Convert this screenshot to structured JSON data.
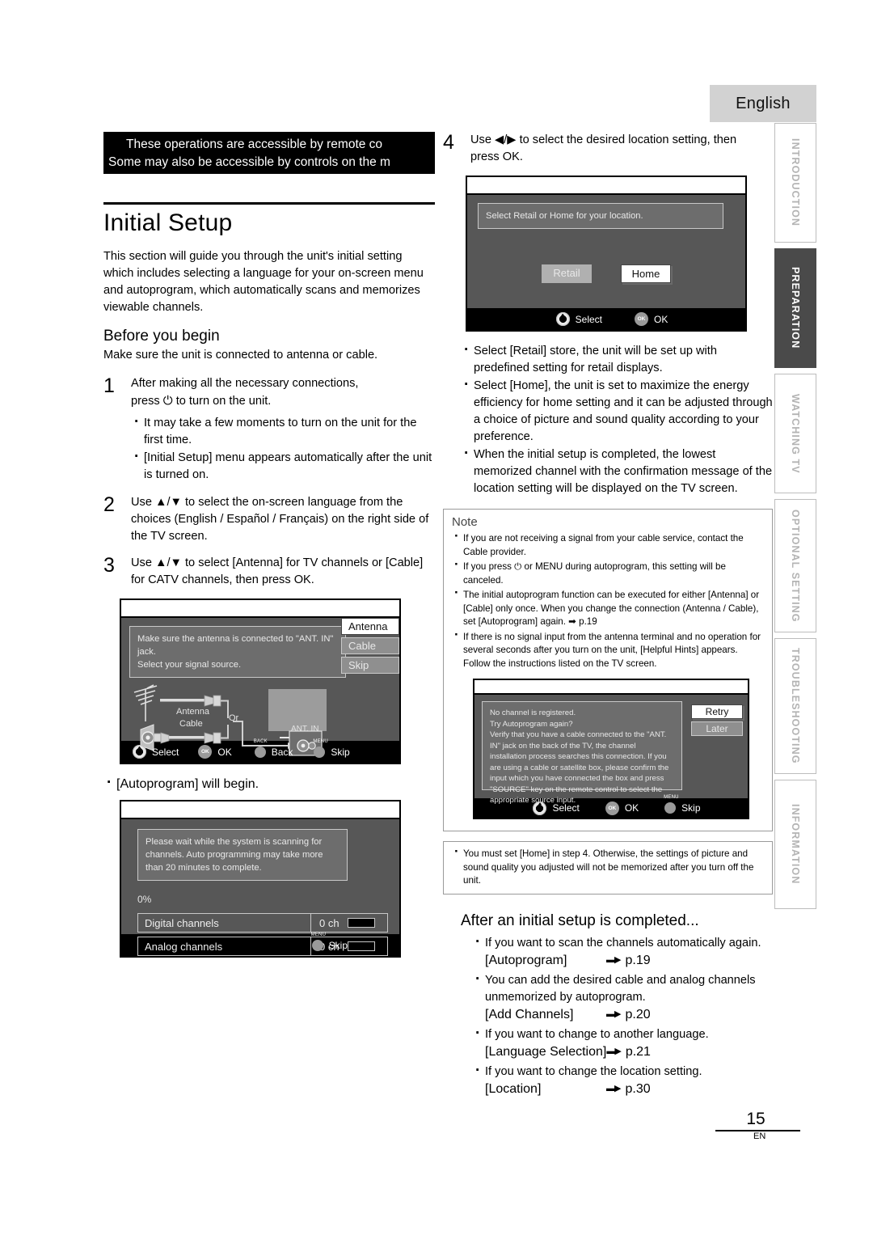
{
  "language_tab": "English",
  "side_tabs": [
    {
      "label": "INTRODUCTION",
      "active": false
    },
    {
      "label": "PREPARATION",
      "active": true
    },
    {
      "label": "WATCHING TV",
      "active": false
    },
    {
      "label": "OPTIONAL SETTING",
      "active": false
    },
    {
      "label": "TROUBLESHOOTING",
      "active": false
    },
    {
      "label": "INFORMATION",
      "active": false
    }
  ],
  "banner": {
    "line1": "These operations are accessible by remote co",
    "line2": "Some may also be accessible by controls on the m"
  },
  "title": "Initial Setup",
  "intro": "This section will guide you through the unit's initial setting which includes selecting a language for your on-screen menu and autoprogram, which automatically scans and memorizes viewable channels.",
  "before": {
    "heading": "Before you begin",
    "text": "Make sure the unit is connected to antenna or cable."
  },
  "steps": {
    "s1": {
      "num": "1",
      "line1": "After making all the necessary connections,",
      "line2_pre": "press",
      "line2_post": "to turn on the unit.",
      "power_icon": "power-icon",
      "bullets": [
        "It may take a few moments to turn on the unit for the first time.",
        "[Initial Setup] menu appears automatically after the unit is turned on."
      ]
    },
    "s2": {
      "num": "2",
      "text": "Use ▲/▼ to select the on-screen language from the choices (English / Español / Français) on the right side of the TV screen."
    },
    "s3": {
      "num": "3",
      "line1": "Use ▲/▼ to select [Antenna] for TV channels or [Cable]",
      "line2": "for CATV channels, then press OK."
    },
    "s4": {
      "num": "4",
      "line1": "Use ◀/▶ to select the desired location setting, then",
      "line2": "press OK."
    }
  },
  "screen_antenna": {
    "message_line1": "Make sure the antenna is connected to \"ANT. IN\" jack.",
    "message_line2": "Select your signal source.",
    "options": [
      {
        "label": "Antenna",
        "selected": true
      },
      {
        "label": "Cable",
        "selected": false
      },
      {
        "label": "Skip",
        "selected": false
      }
    ],
    "diagram": {
      "antenna_label": "Antenna",
      "cable_label": "Cable",
      "or_label": "Or",
      "jack_label": "ANT. IN"
    },
    "keys": [
      {
        "icon": "dpad-icon",
        "label": "Select",
        "cap": ""
      },
      {
        "icon": "ok-button-icon",
        "label": "OK",
        "cap": ""
      },
      {
        "icon": "back-button-icon",
        "label": "Back",
        "cap": "BACK"
      },
      {
        "icon": "menu-button-icon",
        "label": "Skip",
        "cap": "MENU"
      }
    ]
  },
  "autoprogram_note": "[Autoprogram] will begin.",
  "screen_progress": {
    "message": "Please wait while the system is scanning for channels. Auto programming may take more than 20 minutes to complete.",
    "percent": "0%",
    "rows": [
      {
        "name": "Digital channels",
        "count": "0 ch"
      },
      {
        "name": "Analog channels",
        "count": "0 ch"
      }
    ],
    "keys": [
      {
        "icon": "menu-button-icon",
        "label": "Skip",
        "cap": "MENU"
      }
    ]
  },
  "screen_location": {
    "message": "Select  Retail  or  Home  for your location.",
    "options": [
      {
        "label": "Retail",
        "selected": false
      },
      {
        "label": "Home",
        "selected": true
      }
    ],
    "keys": [
      {
        "icon": "dpad-icon",
        "label": "Select",
        "cap": ""
      },
      {
        "icon": "ok-button-icon",
        "label": "OK",
        "cap": ""
      }
    ]
  },
  "location_bullets": [
    "Select [Retail] store, the unit will be set up with predefined setting for retail displays.",
    "Select [Home], the unit is set to maximize the energy efficiency for home setting and it can be adjusted through a choice of picture and sound quality according to your preference.",
    "When the initial setup is completed, the lowest memorized channel with the confirmation message of the location setting will be displayed on the TV screen."
  ],
  "note": {
    "heading": "Note",
    "bullets": [
      "If you are not receiving a signal from your cable service, contact the Cable provider.",
      "If you press ⏻ or MENU during autoprogram, this setting will be canceled.",
      "The initial autoprogram function can be executed for either [Antenna] or [Cable] only once. When you change the connection (Antenna / Cable), set [Autoprogram] again. ➡ p.19",
      "If there is no signal input from the antenna terminal and no operation for several seconds after you turn on the unit, [Helpful Hints] appears. Follow the instructions listed on the TV screen."
    ]
  },
  "screen_nochannel": {
    "message_lines": [
      "No channel is registered.",
      "Try Autoprogram again?",
      "Verify that you have a cable connected to the \"ANT. IN\" jack on the  back of the TV, the channel installation process searches this connection. If you are using a cable or satellite box, please confirm the input which you have connected the box and press \"SOURCE\" key on the remote control to select the appropriate source input."
    ],
    "options": [
      {
        "label": "Retry",
        "selected": true
      },
      {
        "label": "Later",
        "selected": false
      }
    ],
    "keys": [
      {
        "icon": "dpad-icon",
        "label": "Select",
        "cap": ""
      },
      {
        "icon": "ok-button-icon",
        "label": "OK",
        "cap": ""
      },
      {
        "icon": "menu-button-icon",
        "label": "Skip",
        "cap": "MENU"
      }
    ]
  },
  "note2": {
    "bullet": "You must set [Home] in step 4. Otherwise, the settings of picture and sound quality you adjusted will not be memorized after you turn off the unit."
  },
  "after_setup": {
    "heading": "After an initial setup is completed...",
    "items": [
      {
        "desc": "If you want to scan the channels automatically again.",
        "ref": "[Autoprogram]",
        "page": "p.19"
      },
      {
        "desc": "You can add the desired cable and analog channels unmemorized by autoprogram.",
        "ref": "[Add Channels]",
        "page": "p.20"
      },
      {
        "desc": "If you want to change to another language.",
        "ref": "[Language Selection]",
        "page": "p.21"
      },
      {
        "desc": "If you want to change the location setting.",
        "ref": "[Location]",
        "page": "p.30"
      }
    ]
  },
  "page_number": {
    "number": "15",
    "suffix": "EN"
  }
}
